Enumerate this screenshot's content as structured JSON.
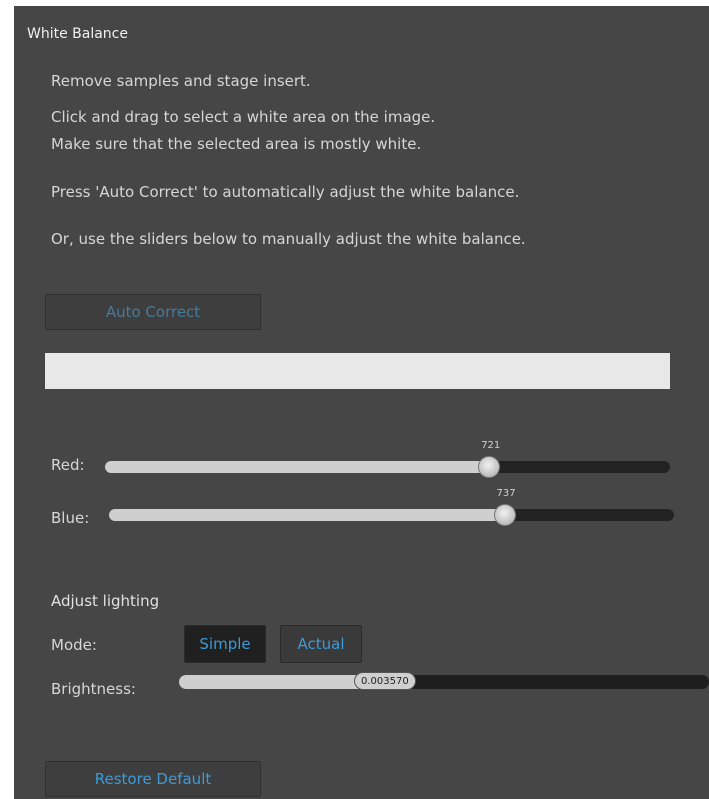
{
  "panel": {
    "title": "White Balance",
    "instructions": [
      "Remove samples and stage insert.",
      "Click and drag to select a white area on the image.",
      "Make sure that the selected area is mostly white.",
      "Press 'Auto Correct' to automatically adjust the white balance.",
      "Or, use the sliders below to manually adjust the white balance."
    ],
    "auto_correct_label": "Auto Correct",
    "swatch_color": "#e8e8e8",
    "sliders": {
      "red": {
        "label": "Red:",
        "value": "721",
        "fraction": 0.68
      },
      "blue": {
        "label": "Blue:",
        "value": "737",
        "fraction": 0.7
      }
    },
    "lighting": {
      "heading": "Adjust lighting",
      "mode_label": "Mode:",
      "modes": [
        "Simple",
        "Actual"
      ],
      "selected_mode": "Simple",
      "brightness_label": "Brightness:",
      "brightness_value": "0.003570"
    },
    "restore_label": "Restore Default"
  },
  "colors": {
    "panel_bg": "#464646",
    "accent": "#3d9ad6",
    "track_dark": "#222222",
    "track_fill": "#cfcfcf"
  }
}
